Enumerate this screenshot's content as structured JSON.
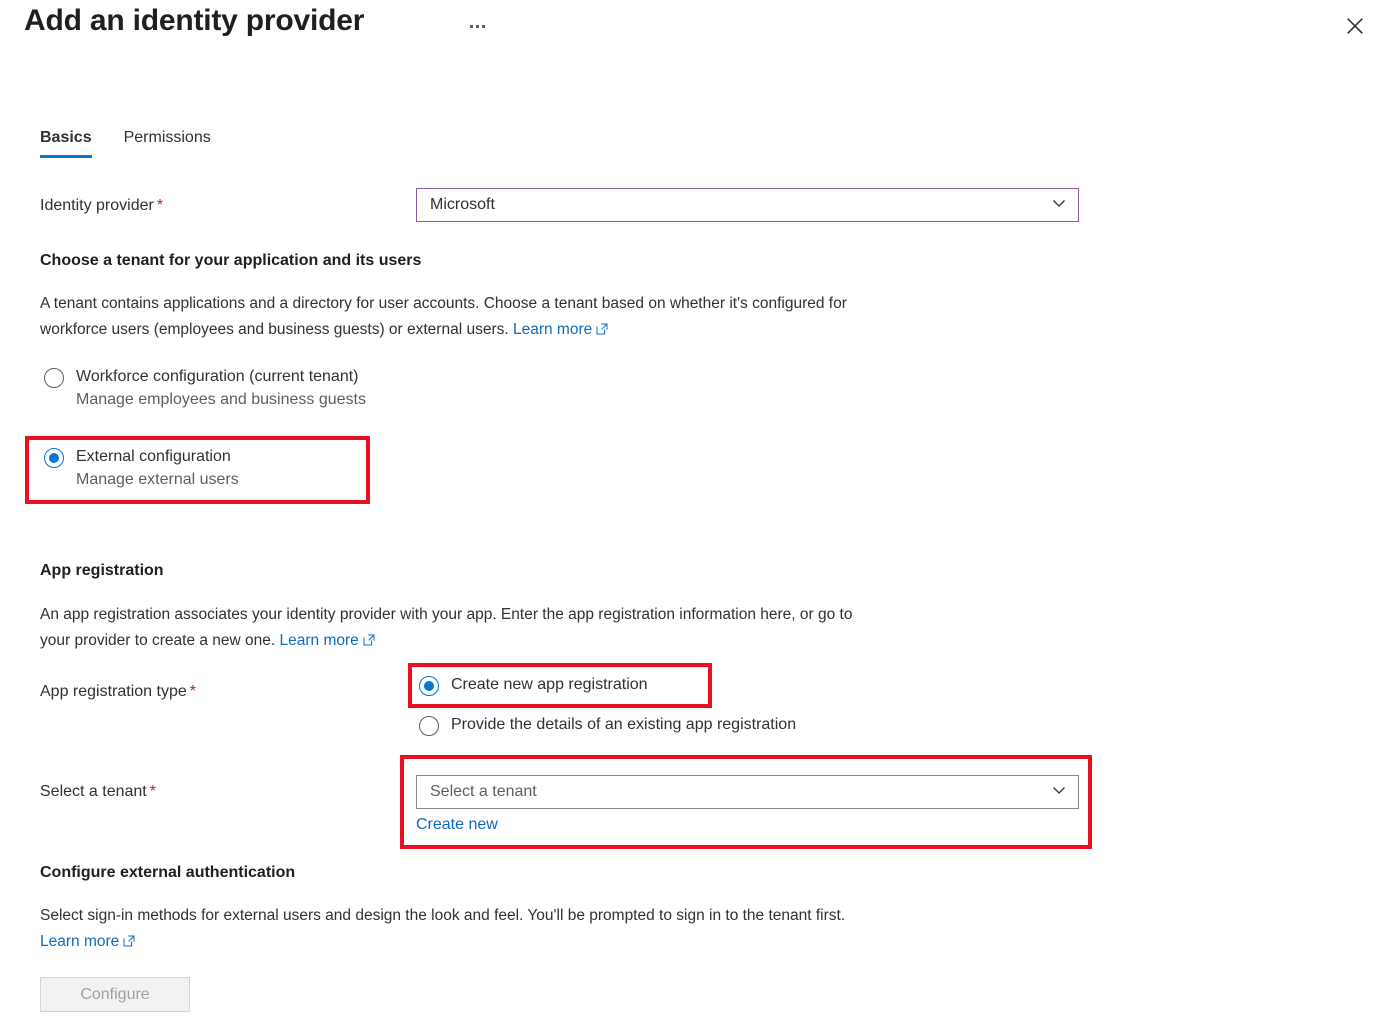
{
  "header": {
    "title": "Add an identity provider",
    "more_menu_label": "···",
    "close_label": "Close"
  },
  "tabs": [
    {
      "label": "Basics",
      "active": true
    },
    {
      "label": "Permissions",
      "active": false
    }
  ],
  "identity_provider": {
    "label": "Identity provider",
    "required_mark": "*",
    "value": "Microsoft"
  },
  "tenant_section": {
    "heading": "Choose a tenant for your application and its users",
    "description_line1": "A tenant contains applications and a directory for user accounts. Choose a tenant based on whether it's configured for",
    "description_line2": "workforce users (employees and business guests) or external users.",
    "learn_more": "Learn more",
    "options": [
      {
        "title": "Workforce configuration (current tenant)",
        "subtitle": "Manage employees and business guests",
        "checked": false
      },
      {
        "title": "External configuration",
        "subtitle": "Manage external users",
        "checked": true
      }
    ]
  },
  "app_registration": {
    "heading": "App registration",
    "description_line1": "An app registration associates your identity provider with your app. Enter the app registration information here, or go to",
    "description_line2": "your provider to create a new one.",
    "learn_more": "Learn more",
    "type_label": "App registration type",
    "type_required_mark": "*",
    "type_options": [
      {
        "title": "Create new app registration",
        "checked": true
      },
      {
        "title": "Provide the details of an existing app registration",
        "checked": false
      }
    ],
    "tenant_label": "Select a tenant",
    "tenant_required_mark": "*",
    "tenant_placeholder": "Select a tenant",
    "create_new_link": "Create new"
  },
  "external_auth": {
    "heading": "Configure external authentication",
    "description": "Select sign-in methods for external users and design the look and feel. You'll be prompted to sign in to the tenant first.",
    "learn_more": "Learn more",
    "configure_button": "Configure"
  },
  "colors": {
    "accent_blue": "#0078d4",
    "link_blue": "#0f6cbd",
    "required_red": "#a4262c",
    "annotation_red": "#e81123",
    "focus_purple": "#8f5ba0"
  }
}
